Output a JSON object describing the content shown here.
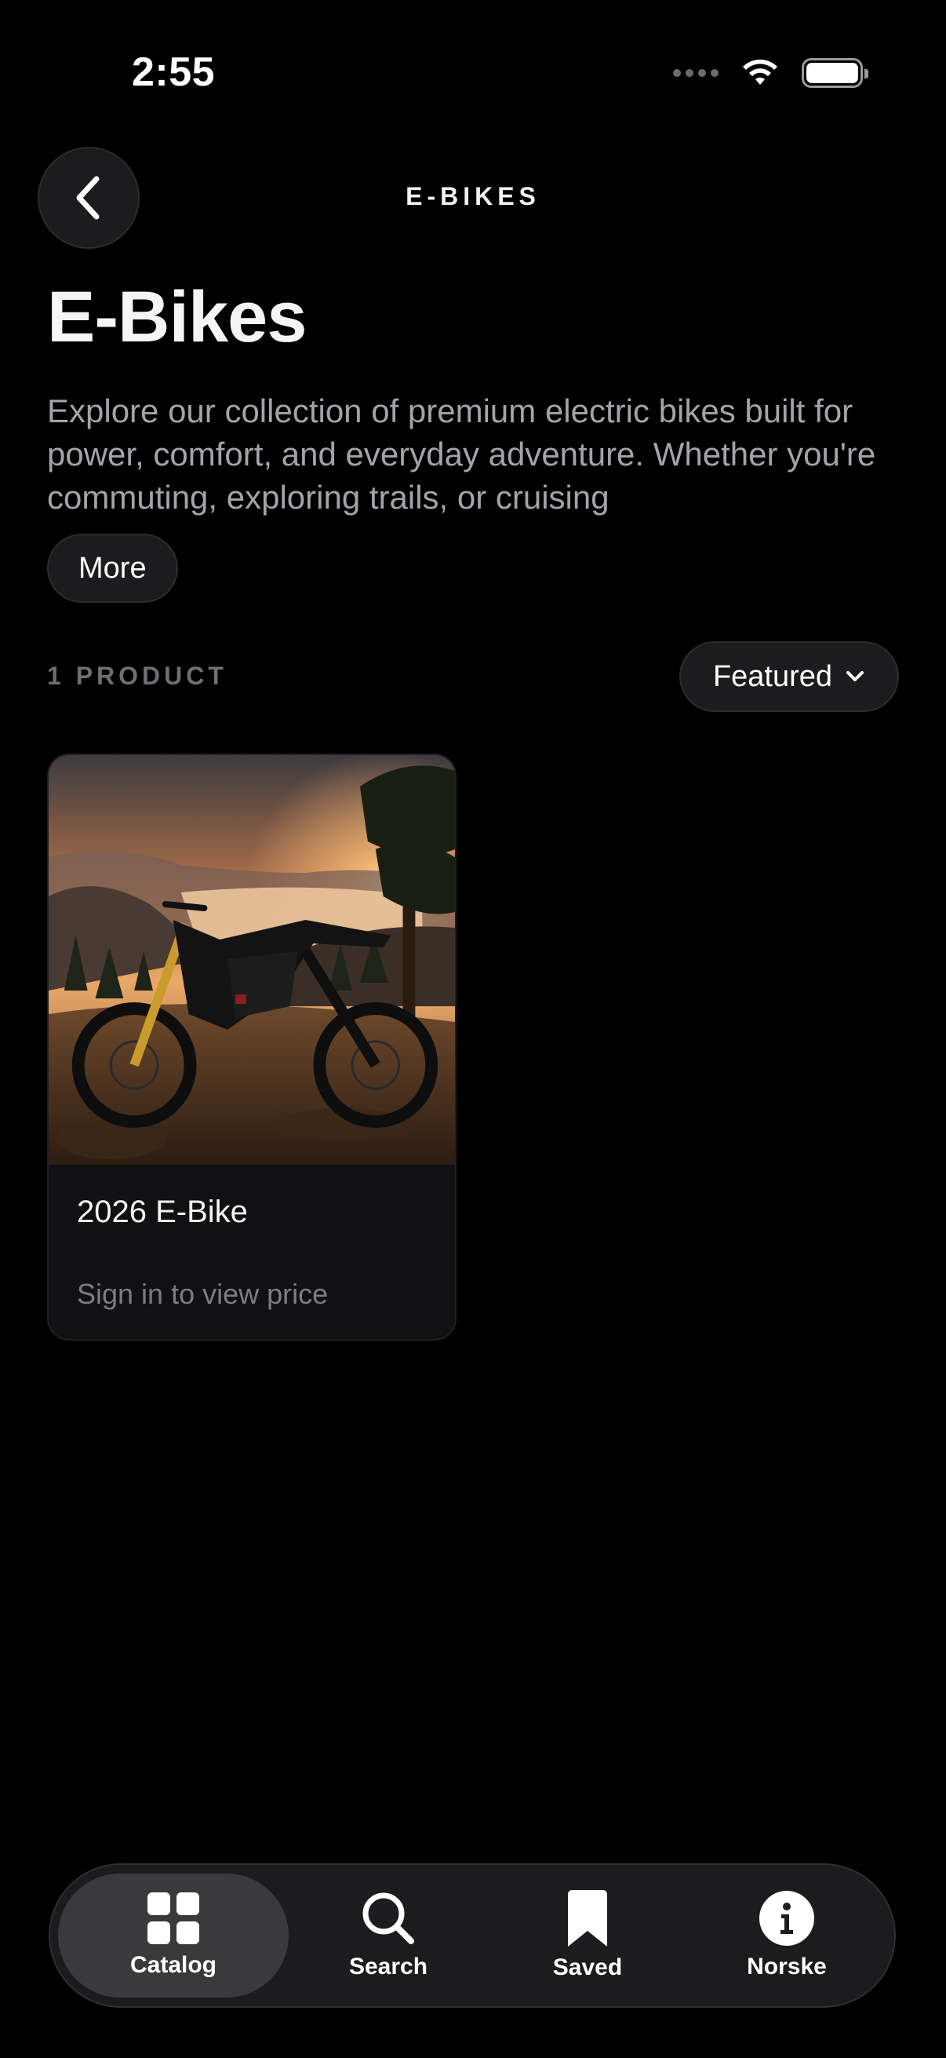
{
  "status_bar": {
    "time": "2:55"
  },
  "header": {
    "title": "E-BIKES",
    "back_icon": "chevron-left-icon"
  },
  "page": {
    "title": "E-Bikes",
    "description": "Explore our collection of premium electric bikes built for power, comfort, and everyday adventure. Whether you're commuting, exploring trails, or cruising",
    "more_label": "More"
  },
  "toolbar": {
    "product_count": "1 PRODUCT",
    "sort_label": "Featured"
  },
  "products": [
    {
      "name": "2026 E-Bike",
      "price_text": "Sign in to view price"
    }
  ],
  "tabbar": {
    "tabs": [
      {
        "label": "Catalog",
        "icon": "grid-icon",
        "active": true
      },
      {
        "label": "Search",
        "icon": "search-icon",
        "active": false
      },
      {
        "label": "Saved",
        "icon": "bookmark-icon",
        "active": false
      },
      {
        "label": "Norske",
        "icon": "info-icon",
        "active": false
      }
    ]
  },
  "colors": {
    "background": "#000000",
    "surface": "#1c1c1e",
    "muted_text": "#a3a3aa",
    "active_tab": "#3a3a3c"
  }
}
